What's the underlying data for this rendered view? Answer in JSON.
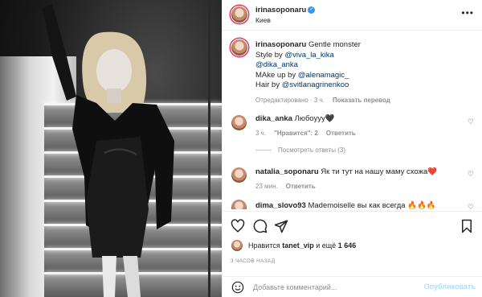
{
  "post": {
    "username": "irinasoponaru",
    "location": "Киев",
    "more_icon": "more-horizontal-icon"
  },
  "caption": {
    "username": "irinasoponaru",
    "line1_text": "Gentle monster",
    "line2_prefix": "Style by ",
    "line2_mention": "@viva_la_kika",
    "line3_mention": "@dika_anka",
    "line4_prefix": "MAke up by ",
    "line4_mention": "@alenamagic_",
    "line5_prefix": "Hair by ",
    "line5_mention": "@svitlanagrinenkoo",
    "edited": "Отредактировано · 3 ч.",
    "translate": "Показать перевод"
  },
  "comments": [
    {
      "username": "dika_anka",
      "text": "Любоууу🖤",
      "time": "3 ч.",
      "likes": "\"Нравится\": 2",
      "reply": "Ответить",
      "view_replies": "Посмотреть ответы (3)"
    },
    {
      "username": "natalia_soponaru",
      "text": "Як ти тут на нашу маму схожа❤️",
      "time": "23 мин.",
      "reply": "Ответить"
    },
    {
      "username": "dima_slovo93",
      "text": "Mademoiselle вы как всегда 🔥🔥🔥"
    }
  ],
  "likes": {
    "prefix": "Нравится ",
    "user": "tanet_vip",
    "middle": " и ещё ",
    "count": "1 646"
  },
  "time_ago": "3 ЧАСОВ НАЗАД",
  "add_comment": {
    "placeholder": "Добавьте комментарий...",
    "post_label": "Опубликовать"
  },
  "colors": {
    "verified": "#3897f0",
    "mention": "#00376b",
    "post_button": "#b2dffc",
    "heart_red": "#ed4956"
  }
}
